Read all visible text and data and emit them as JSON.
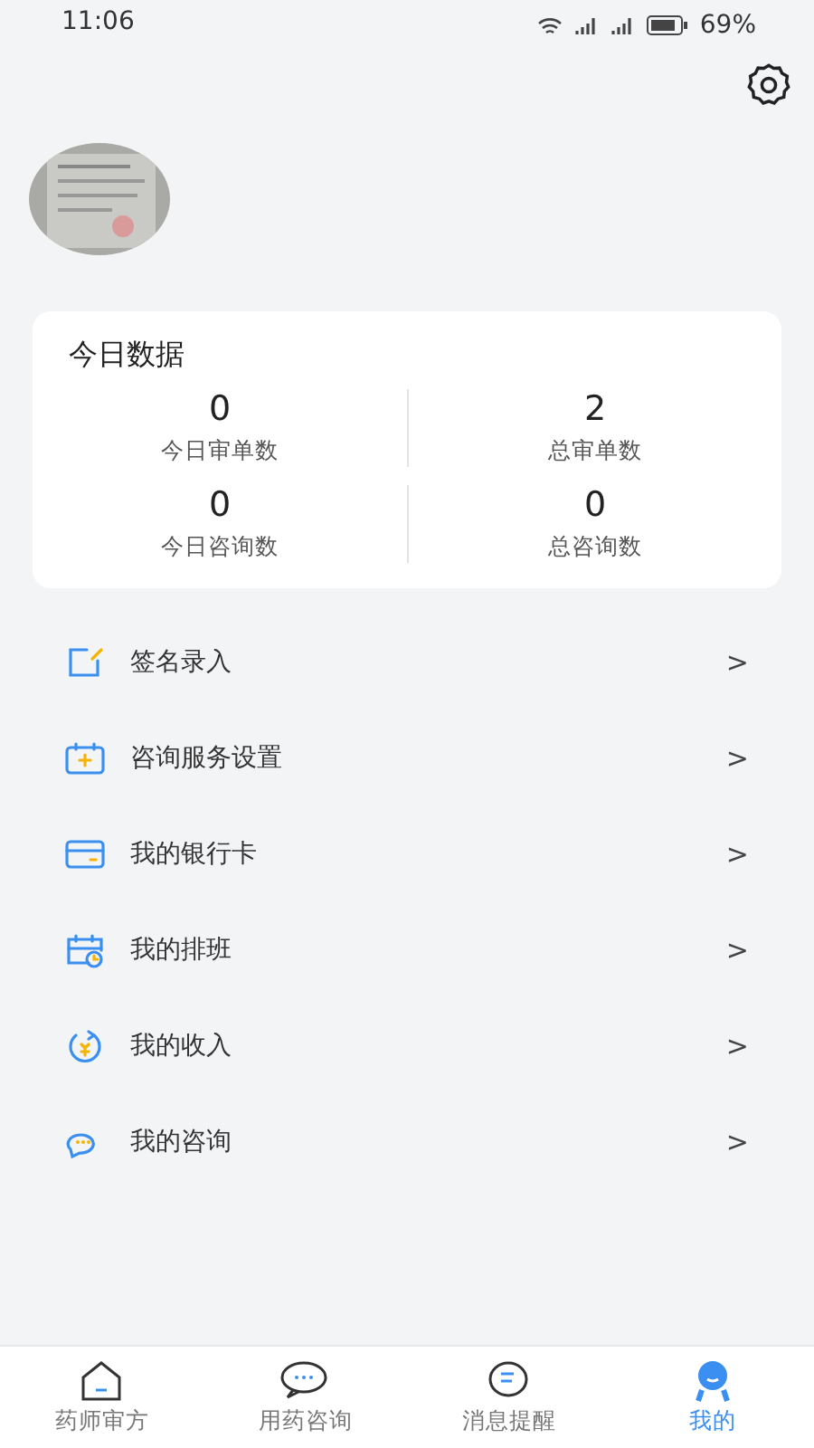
{
  "status_bar": {
    "time": "11:06",
    "battery": "69%"
  },
  "today_stats": {
    "title": "今日数据",
    "stats": [
      {
        "value": "0",
        "label": "今日审单数"
      },
      {
        "value": "2",
        "label": "总审单数"
      },
      {
        "value": "0",
        "label": "今日咨询数"
      },
      {
        "value": "0",
        "label": "总咨询数"
      }
    ]
  },
  "menu": [
    {
      "kind": "signature",
      "label": "签名录入",
      "arrow": ">"
    },
    {
      "kind": "service",
      "label": "咨询服务设置",
      "arrow": ">"
    },
    {
      "kind": "card",
      "label": "我的银行卡",
      "arrow": ">"
    },
    {
      "kind": "schedule",
      "label": "我的排班",
      "arrow": ">"
    },
    {
      "kind": "income",
      "label": "我的收入",
      "arrow": ">"
    },
    {
      "kind": "consult",
      "label": "我的咨询",
      "arrow": ">"
    }
  ],
  "tab_bar": [
    {
      "kind": "home",
      "label": "药师审方",
      "selected": false
    },
    {
      "kind": "chat",
      "label": "用药咨询",
      "selected": false
    },
    {
      "kind": "message",
      "label": "消息提醒",
      "selected": false
    },
    {
      "kind": "me",
      "label": "我的",
      "selected": true
    }
  ]
}
